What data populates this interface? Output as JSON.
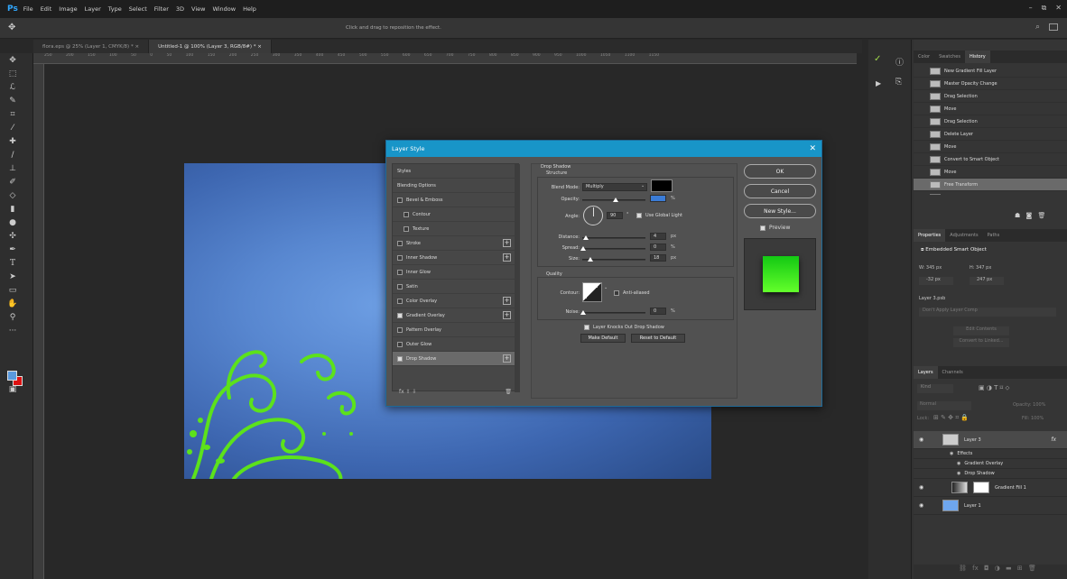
{
  "app": {
    "logo": "Ps",
    "menu": [
      "File",
      "Edit",
      "Image",
      "Layer",
      "Type",
      "Select",
      "Filter",
      "3D",
      "View",
      "Window",
      "Help"
    ]
  },
  "options_bar": {
    "hint": "Click and drag to reposition the effect."
  },
  "tabs": [
    {
      "label": "flora.eps @ 25% (Layer 1, CMYK/8) *  ×"
    },
    {
      "label": "Untitled-1 @ 100% (Layer 3, RGB/8#) *  ×"
    }
  ],
  "ruler_top": "250  200  150  100  50  0  50  100  150  200  250  300  350  400  450  500  550  600  650  700  750  800  850  900  950  1000  1050  1100  1150",
  "dialog": {
    "title": "Layer Style",
    "styles": [
      {
        "label": "Styles",
        "cb": null,
        "sub": false,
        "plus": false,
        "sel": false
      },
      {
        "label": "Blending Options",
        "cb": null,
        "sub": false,
        "plus": false,
        "sel": false
      },
      {
        "label": "Bevel & Emboss",
        "cb": false,
        "sub": false,
        "plus": false,
        "sel": false
      },
      {
        "label": "Contour",
        "cb": false,
        "sub": true,
        "plus": false,
        "sel": false
      },
      {
        "label": "Texture",
        "cb": false,
        "sub": true,
        "plus": false,
        "sel": false
      },
      {
        "label": "Stroke",
        "cb": false,
        "sub": false,
        "plus": true,
        "sel": false
      },
      {
        "label": "Inner Shadow",
        "cb": false,
        "sub": false,
        "plus": true,
        "sel": false
      },
      {
        "label": "Inner Glow",
        "cb": false,
        "sub": false,
        "plus": false,
        "sel": false
      },
      {
        "label": "Satin",
        "cb": false,
        "sub": false,
        "plus": false,
        "sel": false
      },
      {
        "label": "Color Overlay",
        "cb": false,
        "sub": false,
        "plus": true,
        "sel": false
      },
      {
        "label": "Gradient Overlay",
        "cb": true,
        "sub": false,
        "plus": true,
        "sel": false
      },
      {
        "label": "Pattern Overlay",
        "cb": false,
        "sub": false,
        "plus": false,
        "sel": false
      },
      {
        "label": "Outer Glow",
        "cb": false,
        "sub": false,
        "plus": false,
        "sel": false
      },
      {
        "label": "Drop Shadow",
        "cb": true,
        "sub": false,
        "plus": true,
        "sel": true
      }
    ],
    "footer": "fx  ⇧  ⇩",
    "section": "Drop Shadow",
    "structure": "Structure",
    "blend_mode_label": "Blend Mode:",
    "blend_mode": "Multiply",
    "opacity_label": "Opacity:",
    "opacity": "",
    "pct": "%",
    "angle_label": "Angle:",
    "angle": "90",
    "deg": "°",
    "global_light": "Use Global Light",
    "distance_label": "Distance:",
    "distance": "4",
    "spread_label": "Spread:",
    "spread": "0",
    "size_label": "Size:",
    "size": "18",
    "px": "px",
    "quality": "Quality",
    "contour_label": "Contour:",
    "anti_aliased": "Anti-aliased",
    "noise_label": "Noise:",
    "noise": "0",
    "knocks_out": "Layer Knocks Out Drop Shadow",
    "make_default": "Make Default",
    "reset_default": "Reset to Default",
    "ok": "OK",
    "cancel": "Cancel",
    "new_style": "New Style...",
    "preview": "Preview",
    "shadow_color": "#000000"
  },
  "history": {
    "tabs": [
      "Color",
      "Swatches",
      "History"
    ],
    "items": [
      "New Gradient Fill Layer",
      "Master Opacity Change",
      "Drag Selection",
      "Move",
      "Drag Selection",
      "Delete Layer",
      "Move",
      "Convert to Smart Object",
      "Move",
      "Free Transform",
      "Free Transform"
    ]
  },
  "properties": {
    "tabs": [
      "Properties",
      "Adjustments",
      "Paths"
    ],
    "type": "Embedded Smart Object",
    "w": "W: 345 px",
    "h": "H: 347 px",
    "x": "-32 px",
    "y": "247 px",
    "file": "Layer 3.psb",
    "comp": "Don't Apply Layer Comp",
    "edit": "Edit Contents",
    "convert": "Convert to Linked..."
  },
  "layers": {
    "tabs": [
      "Layers",
      "Channels"
    ],
    "kind": "Kind",
    "blend": "Normal",
    "opacity": "Opacity: 100%",
    "lock": "Lock:",
    "fill": "Fill: 100%",
    "rows": [
      {
        "name": "Layer 3",
        "fx": "fx"
      },
      {
        "name": "Effects"
      },
      {
        "name": "Gradient Overlay"
      },
      {
        "name": "Drop Shadow"
      },
      {
        "name": "Gradient Fill 1"
      },
      {
        "name": "Layer 1"
      }
    ]
  }
}
